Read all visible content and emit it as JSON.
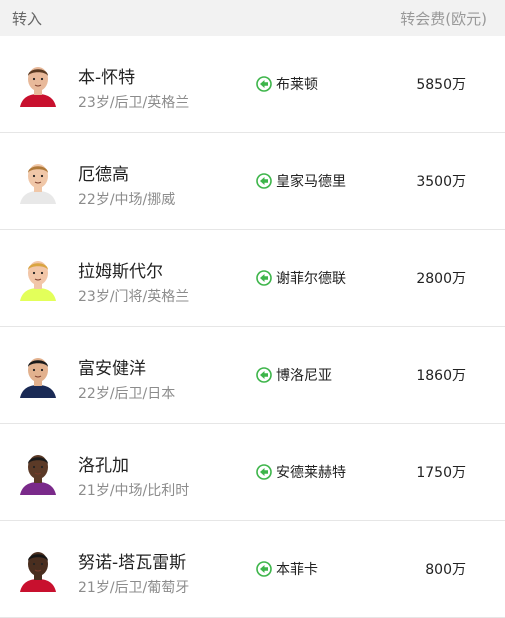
{
  "header": {
    "title": "转入",
    "fee_label": "转会费(欧元)"
  },
  "colors": {
    "arrow_green": "#3db54a",
    "header_bg": "#f2f2f2"
  },
  "rows": [
    {
      "name": "本-怀特",
      "meta": "23岁/后卫/英格兰",
      "club": "布莱顿",
      "fee": "5850万",
      "skin": "#e8b99a",
      "hair": "#5a3a22",
      "shirt": "#c8102e"
    },
    {
      "name": "厄德高",
      "meta": "22岁/中场/挪威",
      "club": "皇家马德里",
      "fee": "3500万",
      "skin": "#f0c7a8",
      "hair": "#b07a3a",
      "shirt": "#e8e8e8"
    },
    {
      "name": "拉姆斯代尔",
      "meta": "23岁/门将/英格兰",
      "club": "谢菲尔德联",
      "fee": "2800万",
      "skin": "#f2c6a8",
      "hair": "#d9a441",
      "shirt": "#e3ff5a"
    },
    {
      "name": "富安健洋",
      "meta": "22岁/后卫/日本",
      "club": "博洛尼亚",
      "fee": "1860万",
      "skin": "#e2b18e",
      "hair": "#1b1b1b",
      "shirt": "#1a2a55"
    },
    {
      "name": "洛孔加",
      "meta": "21岁/中场/比利时",
      "club": "安德莱赫特",
      "fee": "1750万",
      "skin": "#5b3a27",
      "hair": "#1a1a1a",
      "shirt": "#7a2a8a"
    },
    {
      "name": "努诺-塔瓦雷斯",
      "meta": "21岁/后卫/葡萄牙",
      "club": "本菲卡",
      "fee": "800万",
      "skin": "#4a2e1f",
      "hair": "#151515",
      "shirt": "#c8102e"
    }
  ]
}
